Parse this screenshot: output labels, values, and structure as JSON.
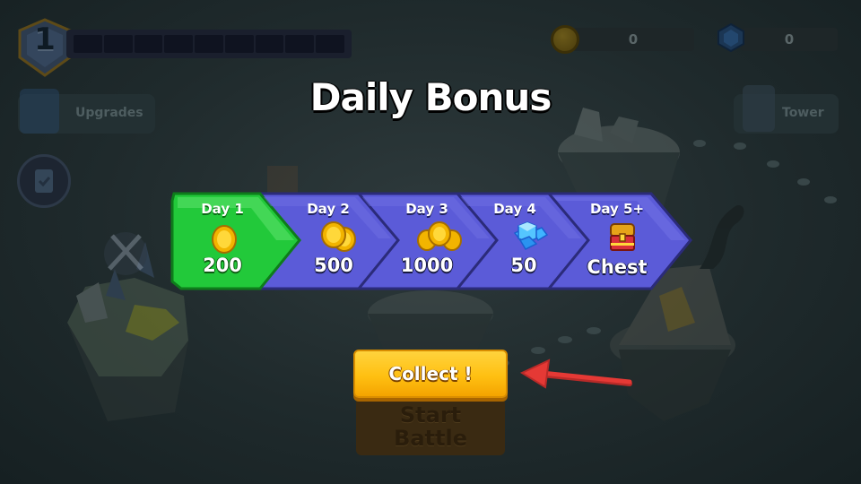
{
  "hud": {
    "level": "1",
    "coins": "0",
    "gems": "0",
    "upgrades_label": "Upgrades",
    "tower_label": "Tower"
  },
  "title": "Daily Bonus",
  "days": [
    {
      "label": "Day 1",
      "value": "200",
      "reward": "coin-icon",
      "state": "active"
    },
    {
      "label": "Day 2",
      "value": "500",
      "reward": "coin-stack-icon",
      "state": "upcoming"
    },
    {
      "label": "Day 3",
      "value": "1000",
      "reward": "coin-pile-icon",
      "state": "upcoming"
    },
    {
      "label": "Day 4",
      "value": "50",
      "reward": "gem-cluster-icon",
      "state": "upcoming"
    },
    {
      "label": "Day 5+",
      "value": "Chest",
      "reward": "treasure-chest-icon",
      "state": "upcoming"
    }
  ],
  "collect_label": "Collect !",
  "start_battle_label_1": "Start",
  "start_battle_label_2": "Battle",
  "colors": {
    "active_day": "#22c93a",
    "upcoming_day": "#5b5bd8",
    "collect_button": "#ffc012",
    "pointer_arrow": "#e53935"
  }
}
